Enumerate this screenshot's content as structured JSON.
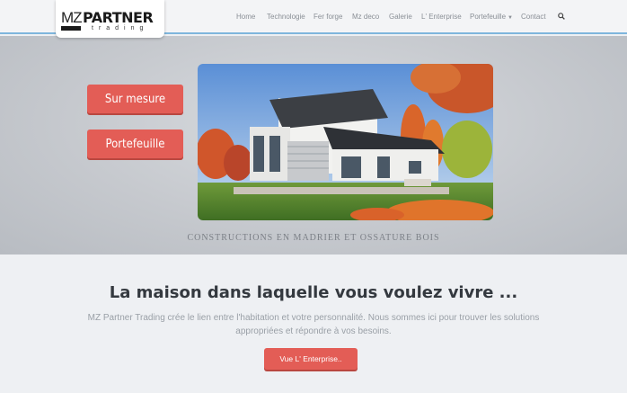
{
  "logo": {
    "mz": "MZ",
    "partner": "PARTNER",
    "trading": "trading"
  },
  "nav": {
    "items": [
      "Home",
      "Technologie",
      "Fer forge",
      "Mz deco",
      "Galerie",
      "L' Enterprise",
      "Portefeuille",
      "Contact"
    ],
    "search_icon": "search-icon"
  },
  "hero": {
    "buttons": [
      "Sur mesure",
      "Portefeuille"
    ],
    "caption": "CONSTRUCTIONS EN MADRIER ET OSSATURE BOIS"
  },
  "content": {
    "headline": "La maison dans laquelle vous voulez vivre ...",
    "description": "MZ Partner Trading crée le lien entre l'habitation et votre personnalité. Nous sommes ici pour trouver les solutions appropriées et répondre à vos besoins.",
    "cta_label": "Vue L' Enterprise.."
  },
  "colors": {
    "accent": "#e35d56",
    "header_border": "#7fb6dc"
  }
}
